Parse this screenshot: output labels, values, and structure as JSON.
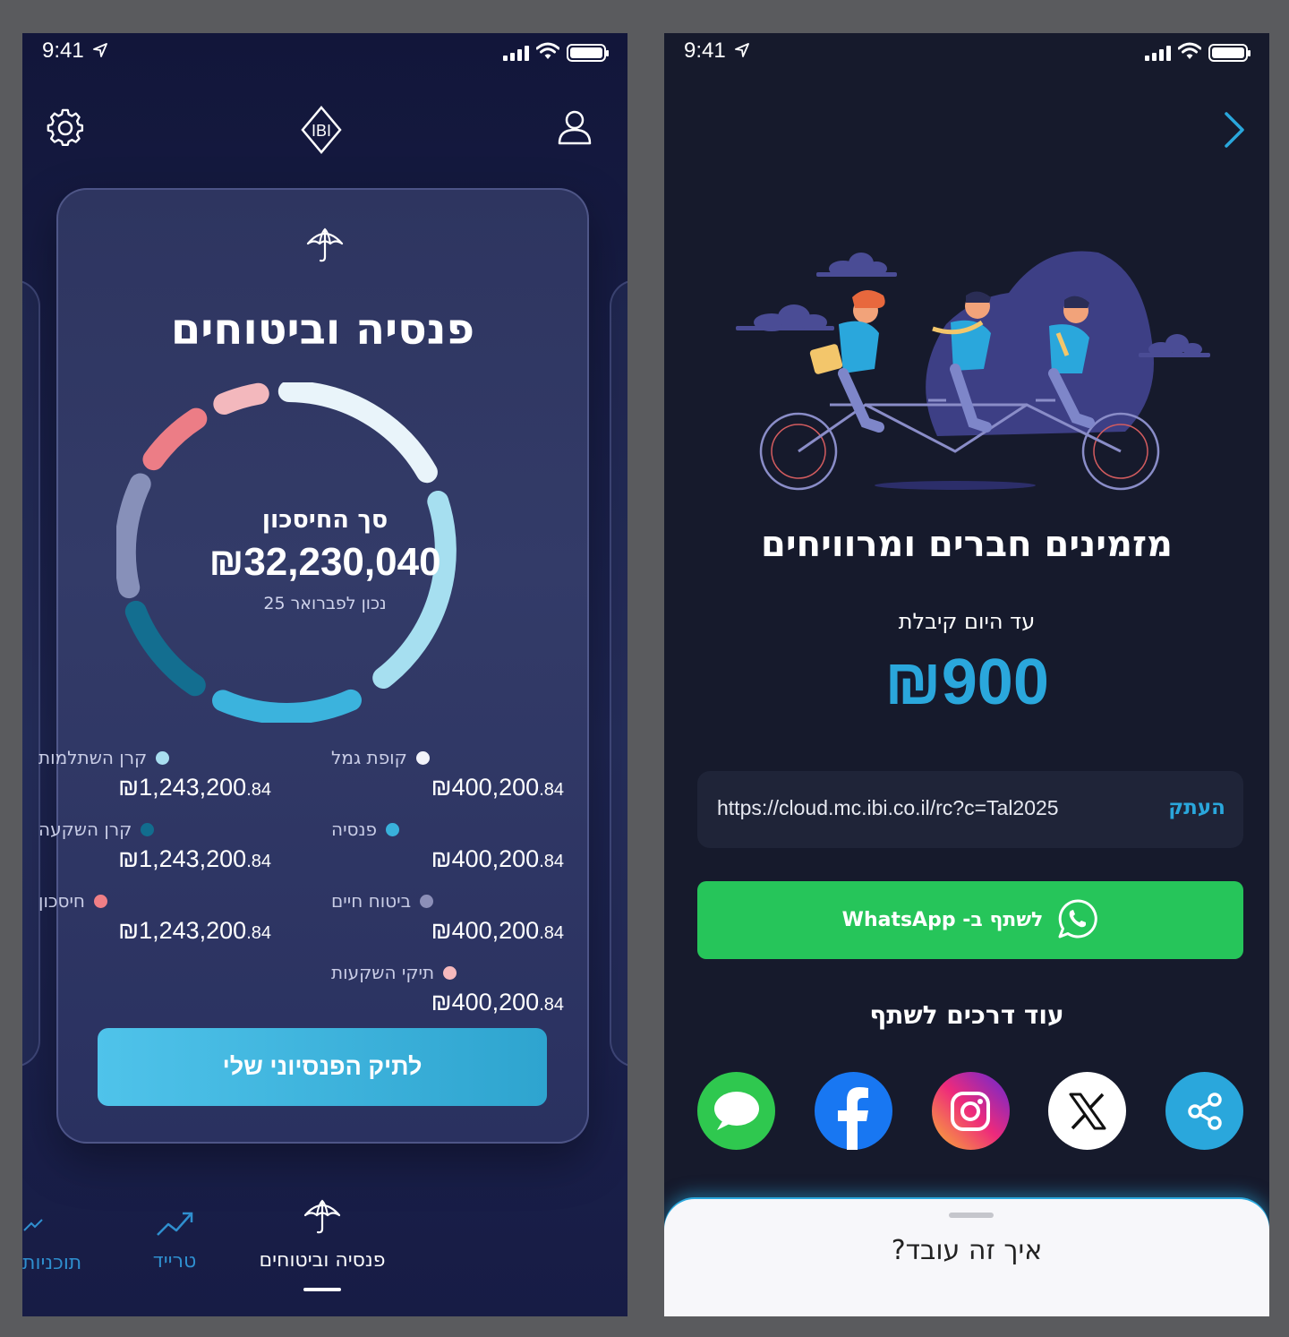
{
  "status_bar": {
    "time": "9:41"
  },
  "phone1": {
    "card": {
      "title": "פנסיה וביטוחים",
      "ring_label": "סך החיסכון",
      "total": "₪32,230,040",
      "date": "נכון לפברואר 25"
    },
    "legend": [
      {
        "name": "קופת גמל",
        "value": "₪400,200",
        "cents": ".84",
        "color": "#f2f3fa"
      },
      {
        "name": "קרן השתלמות",
        "value": "₪1,243,200",
        "cents": ".84",
        "color": "#a9def0"
      },
      {
        "name": "פנסיה",
        "value": "₪400,200",
        "cents": ".84",
        "color": "#39b1db"
      },
      {
        "name": "קרן השקעה",
        "value": "₪1,243,200",
        "cents": ".84",
        "color": "#126d8e"
      },
      {
        "name": "ביטוח חיים",
        "value": "₪400,200",
        "cents": ".84",
        "color": "#8c8fb8"
      },
      {
        "name": "חיסכון",
        "value": "₪1,243,200",
        "cents": ".84",
        "color": "#f07f86"
      },
      {
        "name": "תיקי השקעות",
        "value": "₪400,200",
        "cents": ".84",
        "color": "#f6b9bd"
      }
    ],
    "cta": "לתיק הפנסיוני שלי",
    "nav": {
      "pension": "פנסיה וביטוחים",
      "trade": "טרייד",
      "plans": "תוכניות"
    },
    "icons": {
      "settings": "gear-icon",
      "logo": "IBI",
      "profile": "user-icon"
    }
  },
  "phone2": {
    "title": "מזמינים חברים ומרוויחים",
    "subtitle": "עד היום קיבלת",
    "amount": "₪900",
    "link": "https://cloud.mc.ibi.co.il/rc?c=Tal2025",
    "copy": "העתק",
    "whatsapp": "לשתף ב- WhatsApp",
    "more_title": "עוד דרכים לשתף",
    "sheet_title": "איך זה עובד?",
    "share_apps": [
      "messages-icon",
      "facebook-icon",
      "instagram-icon",
      "x-icon",
      "share-icon"
    ]
  },
  "colors": {
    "accent": "#2aa7dc",
    "whatsapp": "#26c55a",
    "cta_start": "#4fc3ea",
    "cta_end": "#2ea4cf"
  }
}
